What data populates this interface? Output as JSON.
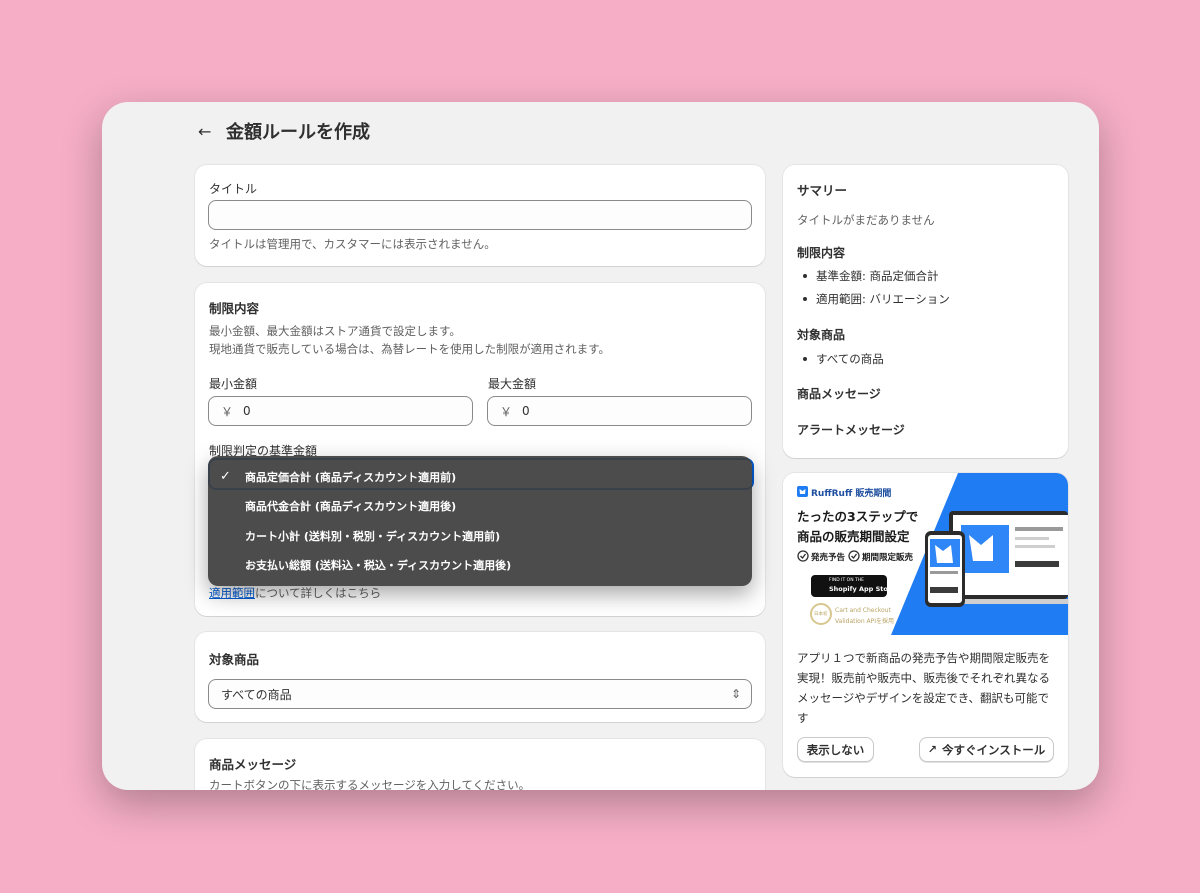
{
  "page": {
    "title": "金額ルールを作成"
  },
  "title_card": {
    "label": "タイトル",
    "value": "",
    "help": "タイトルは管理用で、カスタマーには表示されません。"
  },
  "limits_card": {
    "heading": "制限内容",
    "desc_line1": "最小金額、最大金額はストア通貨で設定します。",
    "desc_line2": "現地通貨で販売している場合は、為替レートを使用した制限が適用されます。",
    "min_label": "最小金額",
    "max_label": "最大金額",
    "currency_symbol": "￥",
    "min_value": "0",
    "max_value": "0",
    "basis_label": "制限判定の基準金額",
    "scope_link": "適用範囲",
    "scope_suffix": "について詳しくはこちら"
  },
  "dropdown": {
    "check": "✓",
    "options": [
      "商品定価合計 (商品ディスカウント適用前)",
      "商品代金合計 (商品ディスカウント適用後)",
      "カート小計 (送料別・税別・ディスカウント適用前)",
      "お支払い総額 (送料込・税込・ディスカウント適用後)"
    ],
    "selected_index": 0
  },
  "target_card": {
    "heading": "対象商品",
    "value": "すべての商品"
  },
  "message_card": {
    "heading": "商品メッセージ",
    "help": "カートボタンの下に表示するメッセージを入力してください。"
  },
  "summary": {
    "heading": "サマリー",
    "no_title": "タイトルがまだありません",
    "limits_heading": "制限内容",
    "limits_items": [
      "基準金額: 商品定価合計",
      "適用範囲: バリエーション"
    ],
    "target_heading": "対象商品",
    "target_items": [
      "すべての商品"
    ],
    "message_heading": "商品メッセージ",
    "alert_heading": "アラートメッセージ"
  },
  "promo": {
    "brand": "RuffRuff 販売期間",
    "headline1": "たったの3ステップで",
    "headline2": "商品の販売期間設定",
    "feature1": "発売予告",
    "feature2": "期間限定販売",
    "badge_small": "FIND IT ON THE",
    "badge_big": "Shopify App Store",
    "seal_text": "日本初",
    "validation_line1": "Cart and Checkout",
    "validation_line2": "Validation APIを採用",
    "body": "アプリ１つで新商品の発売予告や期間限定販売を実現！販売前や販売中、販売後でそれぞれ異なるメッセージやデザインを設定でき、翻訳も可能です",
    "dismiss_label": "表示しない",
    "install_label": "今すぐインストール"
  },
  "colors": {
    "accent": "#0a7cff",
    "link": "#005bd3",
    "background": "#f5aec6"
  },
  "icons": {
    "back": "arrow-left-icon",
    "check": "check-icon",
    "select": "chevron-updown-icon",
    "external": "external-link-icon"
  }
}
